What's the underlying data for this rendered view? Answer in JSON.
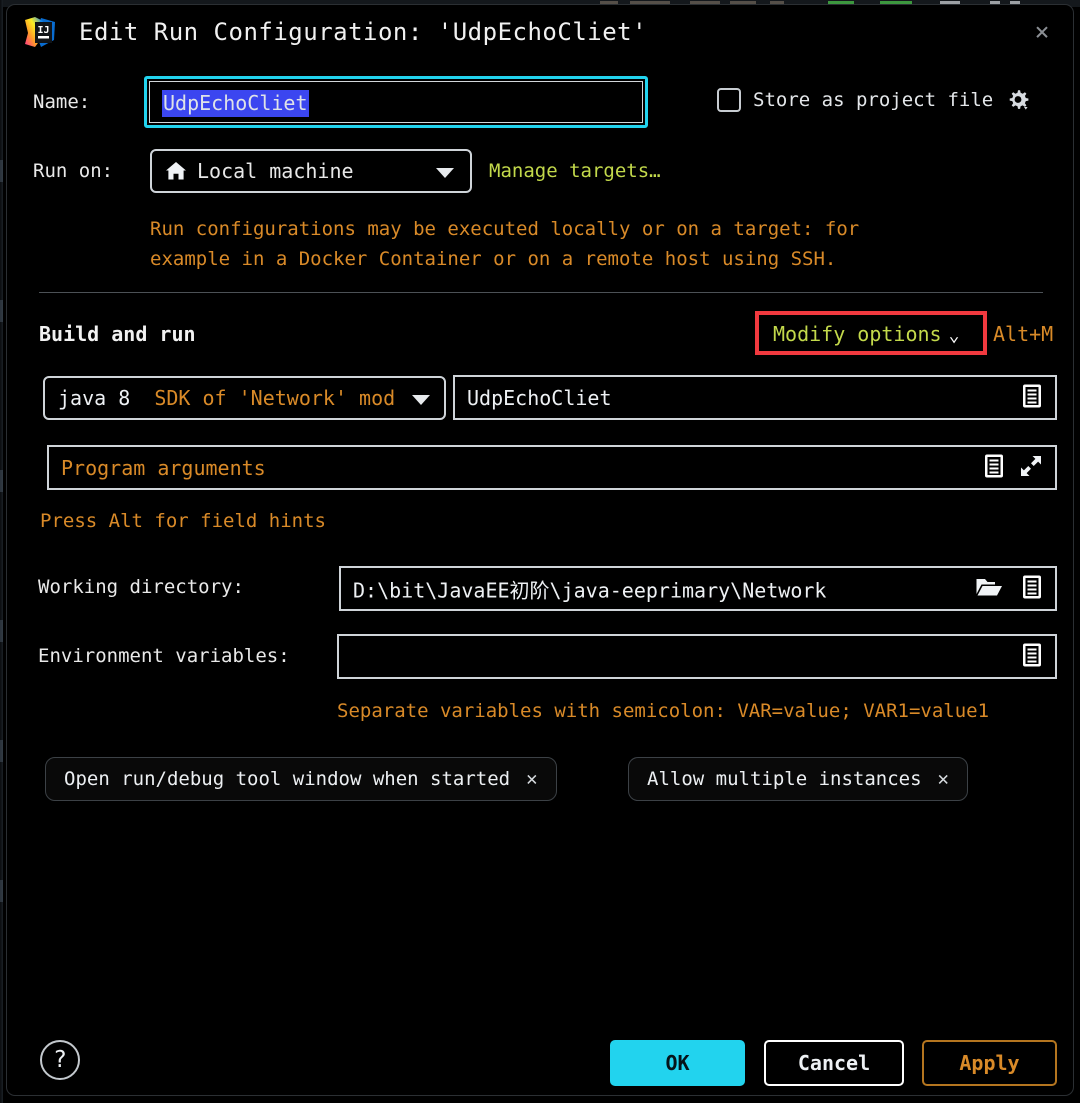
{
  "window": {
    "title": "Edit Run Configuration: 'UdpEchoCliet'",
    "close_label": "×",
    "app_icon": "intellij-idea-logo"
  },
  "name_row": {
    "label": "Name:",
    "value": "UdpEchoCliet",
    "store_checkbox_label": "Store as project file",
    "store_checkbox_checked": false,
    "gear_icon": "gear-icon"
  },
  "run_on_row": {
    "label": "Run on:",
    "selected": "Local machine",
    "target_icon": "home-icon",
    "manage_targets_link": "Manage targets…",
    "hint_line_1": "Run configurations may be executed locally or on a target: for",
    "hint_line_2": "example in a Docker Container or on a remote host using SSH."
  },
  "build_and_run": {
    "section_title": "Build and run",
    "modify_options_label": "Modify options",
    "modify_options_chevron": "⌄",
    "modify_options_shortcut": "Alt+M",
    "jre_module": {
      "jre": "java 8",
      "module": "SDK of 'Network' mod"
    },
    "main_class": {
      "value": "UdpEchoCliet",
      "browse_icon": "list-browse-icon"
    },
    "program_arguments": {
      "placeholder": "Program arguments",
      "browse_icon": "list-browse-icon",
      "expand_icon": "expand-diagonal-icon"
    },
    "field_hints": "Press Alt for field hints"
  },
  "working_directory": {
    "label": "Working directory:",
    "value": "D:\\bit\\JavaEE初阶\\java-eeprimary\\Network",
    "folder_icon": "folder-open-icon",
    "browse_icon": "list-browse-icon"
  },
  "environment_variables": {
    "label": "Environment variables:",
    "value": "",
    "browse_icon": "list-browse-icon",
    "hint": "Separate variables with semicolon: VAR=value; VAR1=value1"
  },
  "option_chips": [
    {
      "label": "Open run/debug tool window when started",
      "remove": "✕"
    },
    {
      "label": "Allow multiple instances",
      "remove": "✕"
    }
  ],
  "footer": {
    "help_label": "?",
    "ok_label": "OK",
    "cancel_label": "Cancel",
    "apply_label": "Apply"
  },
  "colors": {
    "accent_cyan": "#22d3ee",
    "hint_orange": "#d98a28",
    "link_green": "#c3d94b",
    "highlight_red": "#f1393f",
    "selection_blue": "#3b46f0",
    "background": "#000000"
  }
}
